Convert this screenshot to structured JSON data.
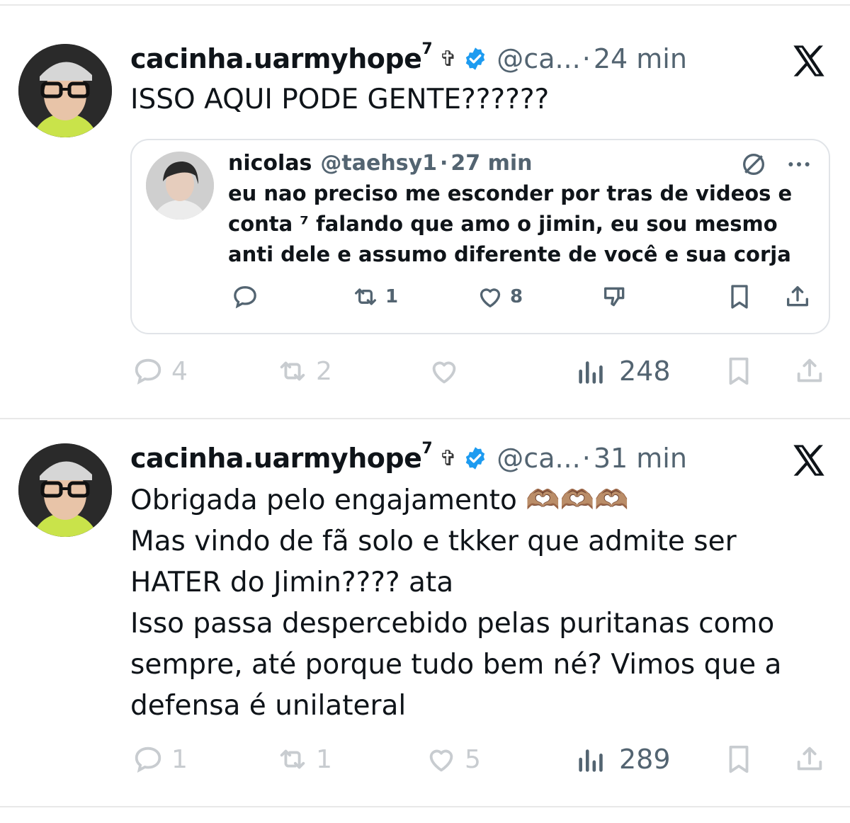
{
  "tweets": [
    {
      "author_name": "cacinha.uarmyhope",
      "author_sup": "7",
      "author_symbol": "✞",
      "handle": "@ca...",
      "separator": "·",
      "time": "24 min",
      "text": "ISSO AQUI PODE GENTE??????",
      "quote": {
        "name": "nicolas",
        "handle": "@taehsy1",
        "separator": "·",
        "time": "27 min",
        "text": "eu nao preciso me esconder por tras de videos e\nconta ⁷ falando que amo o jimin, eu sou mesmo\nanti dele e assumo diferente de você e sua corja",
        "retweets": "1",
        "likes": "8"
      },
      "replies": "4",
      "retweets": "2",
      "likes": "",
      "views": "248"
    },
    {
      "author_name": "cacinha.uarmyhope",
      "author_sup": "7",
      "author_symbol": "✞",
      "handle": "@ca...",
      "separator": "·",
      "time": "31 min",
      "text": "Obrigada pelo engajamento 🫶🏽🫶🏽🫶🏽\nMas vindo de fã solo e tkker que admite ser\nHATER do Jimin???? ata\nIsso passa despercebido pelas puritanas como\nsempre, até porque tudo bem né? Vimos que a\ndefensa é unilateral",
      "replies": "1",
      "retweets": "1",
      "likes": "5",
      "views": "289"
    }
  ],
  "icons": {
    "platform": "x-logo-icon",
    "verified": "verified-badge-icon",
    "reply": "reply-icon",
    "retweet": "retweet-icon",
    "like": "heart-icon",
    "views": "views-icon",
    "bookmark": "bookmark-icon",
    "share": "share-icon",
    "mute": "mute-icon",
    "more": "more-icon",
    "dislike": "dislike-icon"
  },
  "colors": {
    "verified_blue": "#1d9bf0",
    "text_primary": "#0f1419",
    "text_secondary": "#536471",
    "action_muted": "#c8ccd0"
  }
}
